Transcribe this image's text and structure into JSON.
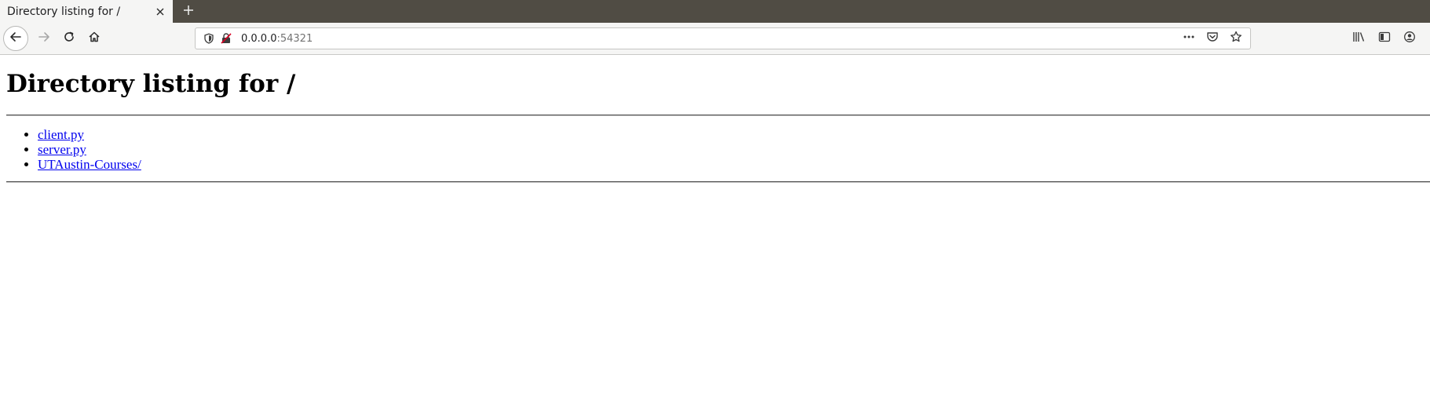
{
  "browser": {
    "tab": {
      "title": "Directory listing for /"
    },
    "urlbar": {
      "host": "0.0.0.0",
      "port": ":54321"
    }
  },
  "page": {
    "heading": "Directory listing for /",
    "entries": [
      {
        "label": "client.py"
      },
      {
        "label": "server.py"
      },
      {
        "label": "UTAustin-Courses/"
      }
    ]
  }
}
